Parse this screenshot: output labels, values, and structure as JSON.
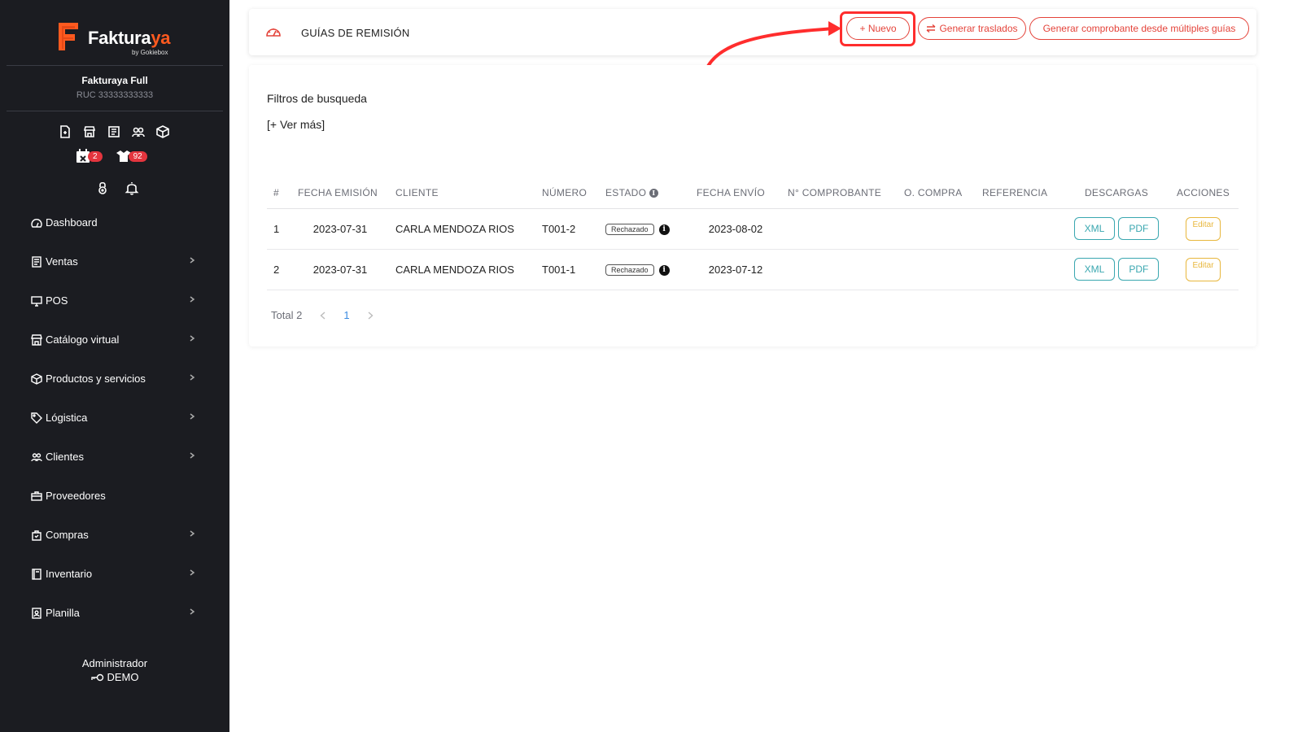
{
  "brand": {
    "name_main": "Faktura",
    "name_accent": "ya",
    "tagline": "by Gokiebox",
    "accent_color": "#ff5a1f"
  },
  "company": {
    "name": "Fakturaya Full",
    "ruc": "RUC 33333333333"
  },
  "sidebar_badges": {
    "calendar_count": "2",
    "boxes_count": "92"
  },
  "menu": [
    {
      "label": "Dashboard",
      "icon": "dashboard-icon",
      "has_submenu": false
    },
    {
      "label": "Ventas",
      "icon": "receipt-icon",
      "has_submenu": true
    },
    {
      "label": "POS",
      "icon": "monitor-icon",
      "has_submenu": true
    },
    {
      "label": "Catálogo virtual",
      "icon": "store-icon",
      "has_submenu": true
    },
    {
      "label": "Productos y servicios",
      "icon": "box-icon",
      "has_submenu": true
    },
    {
      "label": "Lógistica",
      "icon": "tag-icon",
      "has_submenu": true
    },
    {
      "label": "Clientes",
      "icon": "users-icon",
      "has_submenu": true
    },
    {
      "label": "Proveedores",
      "icon": "briefcase-icon",
      "has_submenu": false
    },
    {
      "label": "Compras",
      "icon": "bag-icon",
      "has_submenu": true
    },
    {
      "label": "Inventario",
      "icon": "book-icon",
      "has_submenu": true
    },
    {
      "label": "Planilla",
      "icon": "id-card-icon",
      "has_submenu": true
    }
  ],
  "user": {
    "role": "Administrador",
    "name": "DEMO"
  },
  "header": {
    "title": "GUÍAS DE REMISIÓN",
    "btn_nuevo": "+ Nuevo",
    "btn_traslados": "Generar traslados",
    "btn_multi": "Generar comprobante desde múltiples guías",
    "accent_color": "#e4433a"
  },
  "filters": {
    "title": "Filtros de busqueda",
    "more": "[+ Ver más]"
  },
  "table": {
    "headers": [
      "#",
      "FECHA EMISIÓN",
      "CLIENTE",
      "NÚMERO",
      "ESTADO",
      "FECHA ENVÍO",
      "N° COMPROBANTE",
      "O. COMPRA",
      "REFERENCIA",
      "DESCARGAS",
      "ACCIONES"
    ],
    "rows": [
      {
        "num": "1",
        "fecha_emision": "2023-07-31",
        "cliente": "CARLA MENDOZA RIOS",
        "numero": "T001-2",
        "estado": "Rechazado",
        "fecha_envio": "2023-08-02",
        "comprobante": "",
        "compra": "",
        "referencia": "",
        "xml": "XML",
        "pdf": "PDF",
        "accion": "Editar"
      },
      {
        "num": "2",
        "fecha_emision": "2023-07-31",
        "cliente": "CARLA MENDOZA RIOS",
        "numero": "T001-1",
        "estado": "Rechazado",
        "fecha_envio": "2023-07-12",
        "comprobante": "",
        "compra": "",
        "referencia": "",
        "xml": "XML",
        "pdf": "PDF",
        "accion": "Editar"
      }
    ]
  },
  "pagination": {
    "total": "Total 2",
    "current_page": "1"
  }
}
